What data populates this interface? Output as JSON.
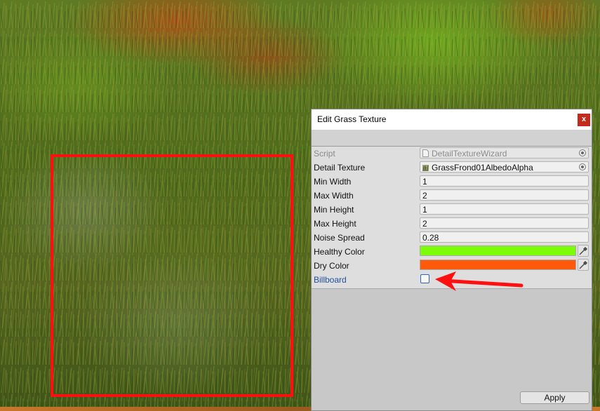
{
  "window": {
    "title": "Edit Grass Texture",
    "close_label": "x"
  },
  "properties": [
    {
      "label": "Script",
      "value": "DetailTextureWizard",
      "kind": "object",
      "disabled": true
    },
    {
      "label": "Detail Texture",
      "value": "GrassFrond01AlbedoAlpha",
      "kind": "object"
    },
    {
      "label": "Min Width",
      "value": "1",
      "kind": "number"
    },
    {
      "label": "Max Width",
      "value": "2",
      "kind": "number"
    },
    {
      "label": "Min Height",
      "value": "1",
      "kind": "number"
    },
    {
      "label": "Max Height",
      "value": "2",
      "kind": "number"
    },
    {
      "label": "Noise Spread",
      "value": "0.28",
      "kind": "number"
    },
    {
      "label": "Healthy Color",
      "color": "#7cfc0a",
      "kind": "color"
    },
    {
      "label": "Dry Color",
      "color": "#ff5a0a",
      "kind": "color"
    },
    {
      "label": "Billboard",
      "checked": false,
      "kind": "checkbox"
    }
  ],
  "apply_label": "Apply",
  "annotation": {
    "highlight_color": "#ff1010",
    "arrow_color": "#ff1010"
  },
  "icons": {
    "script_icon": "file-icon",
    "texture_icon": "grass-texture-icon",
    "object_picker": "object-picker-icon",
    "eyedropper": "eyedropper-icon"
  }
}
